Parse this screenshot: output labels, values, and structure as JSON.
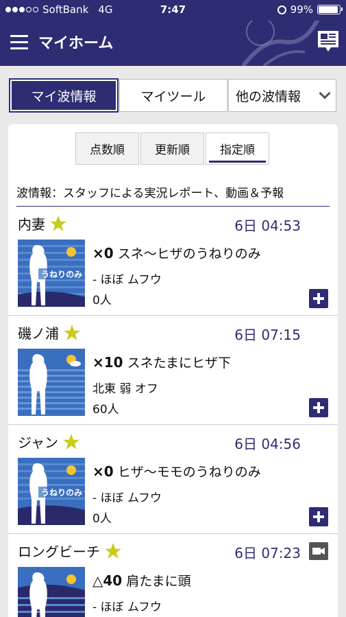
{
  "status": {
    "carrier": "SoftBank",
    "network": "4G",
    "time": "7:47",
    "battery": "99%"
  },
  "header": {
    "title": "マイホーム"
  },
  "tabs": [
    "マイ波情報",
    "マイツール",
    "他の波情報"
  ],
  "sort_tabs": [
    "点数順",
    "更新順",
    "指定順"
  ],
  "description": "波情報：スタッフによる実況レポート、動画＆予報",
  "thumb_label": "うねりのみ",
  "spots": [
    {
      "name": "内妻",
      "date": "6日 04:53",
      "rank": "×0",
      "size": "スネ〜ヒザのうねりのみ",
      "wind": "- ほぼ ムフウ",
      "people": "0人",
      "thumb_text": "うねりのみ"
    },
    {
      "name": "磯ノ浦",
      "date": "6日 07:15",
      "rank": "×10",
      "size": "スネたまにヒザ下",
      "wind": "北東 弱 オフ",
      "people": "60人",
      "thumb_text": ""
    },
    {
      "name": "ジャン",
      "date": "6日 04:56",
      "rank": "×0",
      "size": "ヒザ〜モモのうねりのみ",
      "wind": "- ほぼ ムフウ",
      "people": "0人",
      "thumb_text": "うねりのみ"
    },
    {
      "name": "ロングビーチ",
      "date": "6日 07:23",
      "rank": "△40",
      "size": "肩たまに頭",
      "wind": "- ほぼ ムフウ",
      "people": "",
      "thumb_text": ""
    }
  ],
  "colors": {
    "brand": "#2e2c73",
    "star": "#c8cc1e",
    "thumb": "#3a6fc0"
  }
}
